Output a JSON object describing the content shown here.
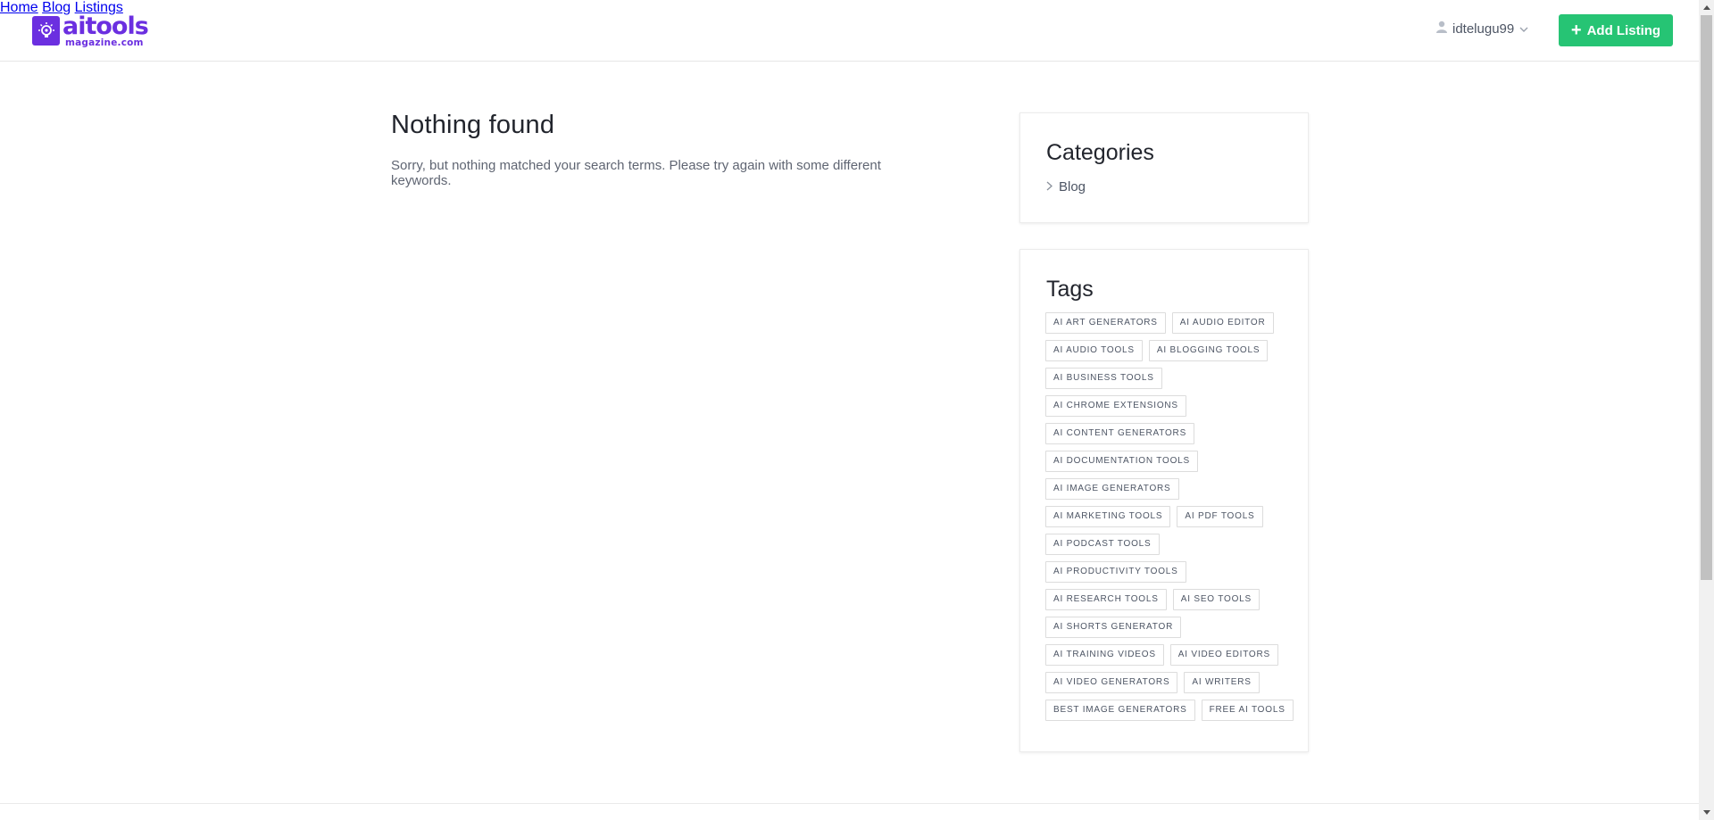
{
  "header": {
    "logo": {
      "main": "aitools",
      "sub": "magazine.com"
    },
    "nav": {
      "home": "Home",
      "blog": "Blog",
      "listings": "Listings"
    },
    "user": {
      "name": "idtelugu99"
    },
    "add_listing_label": "Add Listing"
  },
  "main": {
    "title": "Nothing found",
    "message": "Sorry, but nothing matched your search terms. Please try again with some different keywords."
  },
  "sidebar": {
    "categories": {
      "title": "Categories",
      "items": [
        "Blog"
      ]
    },
    "tags": {
      "title": "Tags",
      "rows": [
        [
          "AI ART GENERATORS",
          "AI AUDIO EDITOR"
        ],
        [
          "AI AUDIO TOOLS",
          "AI BLOGGING TOOLS"
        ],
        [
          "AI BUSINESS TOOLS"
        ],
        [
          "AI CHROME EXTENSIONS"
        ],
        [
          "AI CONTENT GENERATORS"
        ],
        [
          "AI DOCUMENTATION TOOLS"
        ],
        [
          "AI IMAGE GENERATORS"
        ],
        [
          "AI MARKETING TOOLS",
          "AI PDF TOOLS"
        ],
        [
          "AI PODCAST TOOLS"
        ],
        [
          "AI PRODUCTIVITY TOOLS"
        ],
        [
          "AI RESEARCH TOOLS",
          "AI SEO TOOLS"
        ],
        [
          "AI SHORTS GENERATOR"
        ],
        [
          "AI TRAINING VIDEOS",
          "AI VIDEO EDITORS"
        ],
        [
          "AI VIDEO GENERATORS",
          "AI WRITERS"
        ],
        [
          "BEST IMAGE GENERATORS",
          "FREE AI TOOLS"
        ]
      ]
    }
  },
  "colors": {
    "brand": "#6b2fe0",
    "accent_button": "#26c474",
    "text": "#4d5564",
    "heading": "#22252d"
  },
  "icons": {
    "logo": "lightbulb-gear-icon",
    "user": "user-icon",
    "user_menu": "chevron-down-icon",
    "add": "plus-icon",
    "category": "chevron-right-icon"
  }
}
